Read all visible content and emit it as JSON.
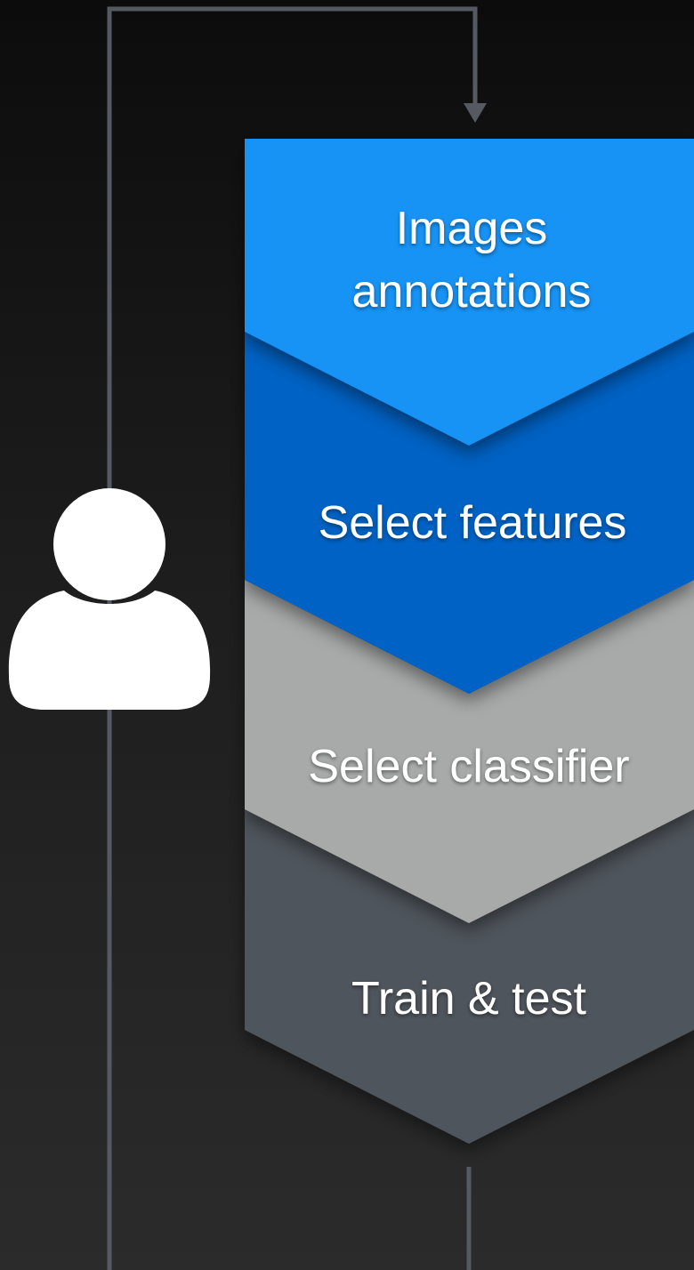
{
  "stages": [
    {
      "lines": [
        "Images",
        "annotations"
      ],
      "color": "#1493f5"
    },
    {
      "lines": [
        "Select features"
      ],
      "color": "#0062c4"
    },
    {
      "lines": [
        "Select classifier"
      ],
      "color": "#a7aaa9"
    },
    {
      "lines": [
        "Train & test"
      ],
      "color": "#50545b"
    }
  ],
  "connector_color": "#555a62",
  "user_icon": "user-icon"
}
